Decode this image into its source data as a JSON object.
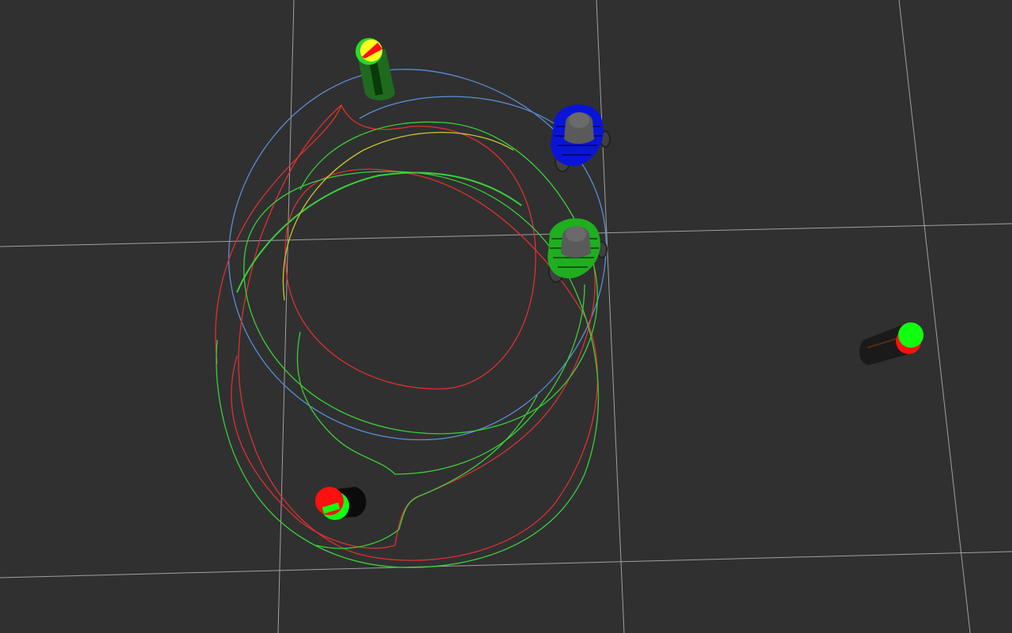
{
  "scene": {
    "background": "#303030",
    "grid_color": "#9a9a9a",
    "colors": {
      "blue_path": "#5a8fd6",
      "red_path": "#e03030",
      "green_path": "#3ad03a",
      "yellow_path": "#c8c830",
      "robot_blue": "#0a14d8",
      "robot_green": "#1fae1f",
      "robot_dark": "#505050",
      "marker_red": "#ff1010",
      "marker_green": "#10ff10",
      "marker_yellow": "#ffff20"
    },
    "objects": [
      {
        "name": "robot-blue",
        "icon": "robot-icon"
      },
      {
        "name": "robot-green",
        "icon": "robot-icon"
      },
      {
        "name": "obstacle-top",
        "icon": "cylinder-icon"
      },
      {
        "name": "obstacle-bottom",
        "icon": "cylinder-icon"
      },
      {
        "name": "obstacle-right",
        "icon": "cylinder-icon"
      }
    ]
  }
}
